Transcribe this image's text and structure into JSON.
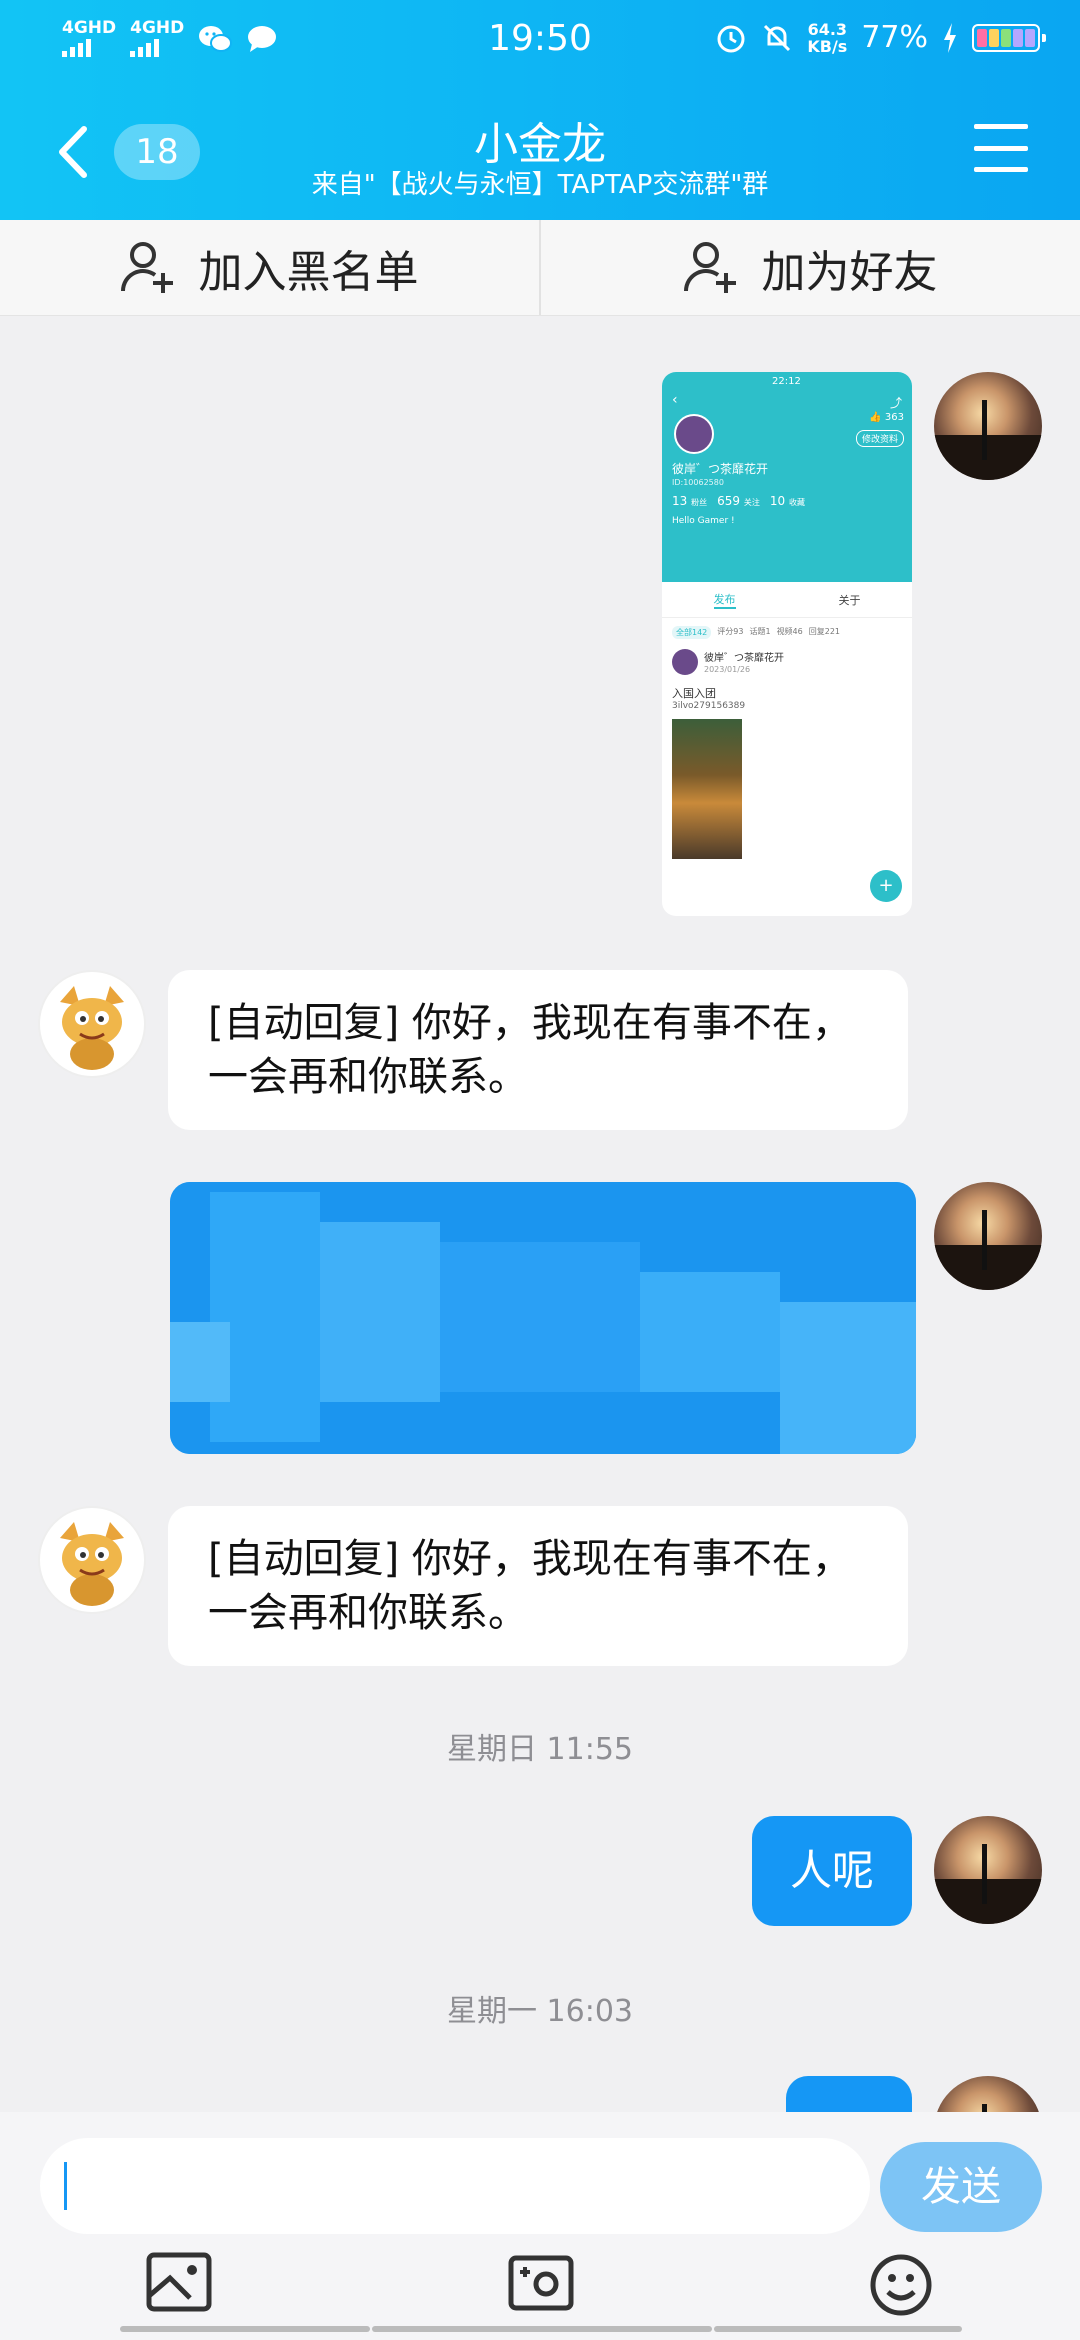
{
  "status": {
    "net1": "4GHD",
    "net2": "4GHD",
    "time": "19:50",
    "speed_value": "64.3",
    "speed_unit": "KB/s",
    "battery": "77%"
  },
  "header": {
    "unread_count": "18",
    "title": "小金龙",
    "subtitle": "来自\"【战火与永恒】TAPTAP交流群\"群"
  },
  "actions": {
    "blacklist": "加入黑名单",
    "add_friend": "加为好友"
  },
  "shared_screenshot": {
    "time": "22:12",
    "likes": "363",
    "edit_label": "修改资料",
    "user_name": "彼岸゛つ茶靡花开",
    "user_id": "ID:10062580",
    "fans_count": "13",
    "fans_label": "粉丝",
    "follow_count": "659",
    "follow_label": "关注",
    "fav_count": "10",
    "fav_label": "收藏",
    "bio": "Hello Gamer !",
    "tab_posts": "发布",
    "tab_about": "关于",
    "filters": [
      "全部142",
      "评分93",
      "话题1",
      "视频46",
      "回复221"
    ],
    "post_author": "彼岸゛つ茶靡花开",
    "post_date": "2023/01/26",
    "post_title": "入国入团",
    "post_body": "3ilvo279156389"
  },
  "messages": {
    "auto_reply_1": "[自动回复] 你好，我现在有事不在，一会再和你联系。",
    "auto_reply_2": "[自动回复] 你好，我现在有事不在，一会再和你联系。",
    "time_1": "星期日 11:55",
    "self_msg": "人呢",
    "time_2": "星期一 16:03"
  },
  "composer": {
    "send_label": "发送",
    "input_value": ""
  },
  "colors": {
    "header_start": "#12c4f5",
    "header_end": "#0aa6f2",
    "self_bubble": "#1597f5",
    "send_button": "#7dc4f5"
  },
  "icons": [
    "back-arrow-icon",
    "menu-icon",
    "add-user-icon",
    "image-icon",
    "camera-icon",
    "emoji-icon"
  ]
}
